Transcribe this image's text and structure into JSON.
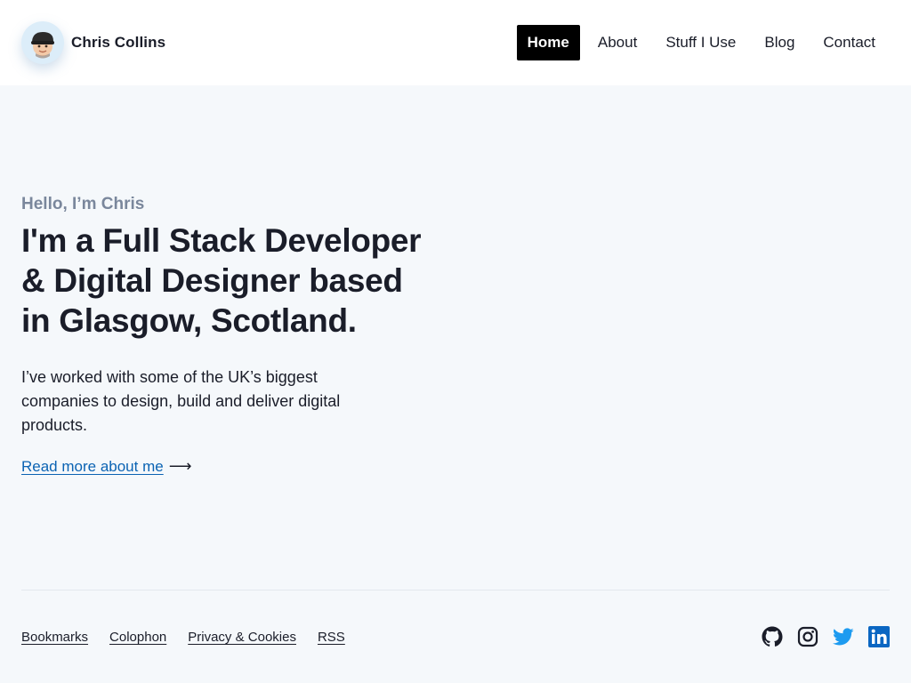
{
  "header": {
    "brand_name": "Chris Collins",
    "nav": [
      {
        "label": "Home",
        "active": true
      },
      {
        "label": "About",
        "active": false
      },
      {
        "label": "Stuff I Use",
        "active": false
      },
      {
        "label": "Blog",
        "active": false
      },
      {
        "label": "Contact",
        "active": false
      }
    ]
  },
  "hero": {
    "eyebrow": "Hello, I’m Chris",
    "heading": "I'm a Full Stack Developer & Digital Designer based in Glasgow, Scotland.",
    "lede": "I’ve worked with some of the UK’s biggest companies to design, build and deliver digital products.",
    "cta_label": "Read more about me",
    "cta_arrow": "⟶"
  },
  "footer": {
    "links": [
      "Bookmarks",
      "Colophon",
      "Privacy & Cookies",
      "RSS"
    ],
    "social": [
      {
        "icon": "github-icon"
      },
      {
        "icon": "instagram-icon"
      },
      {
        "icon": "twitter-icon"
      },
      {
        "icon": "linkedin-icon"
      }
    ]
  },
  "colors": {
    "background": "#f5f8fb",
    "text": "#1a1d29",
    "eyebrow": "#7a879c",
    "link": "#0b63b3",
    "twitter": "#1d9bf0",
    "linkedin": "#0a66c2"
  }
}
